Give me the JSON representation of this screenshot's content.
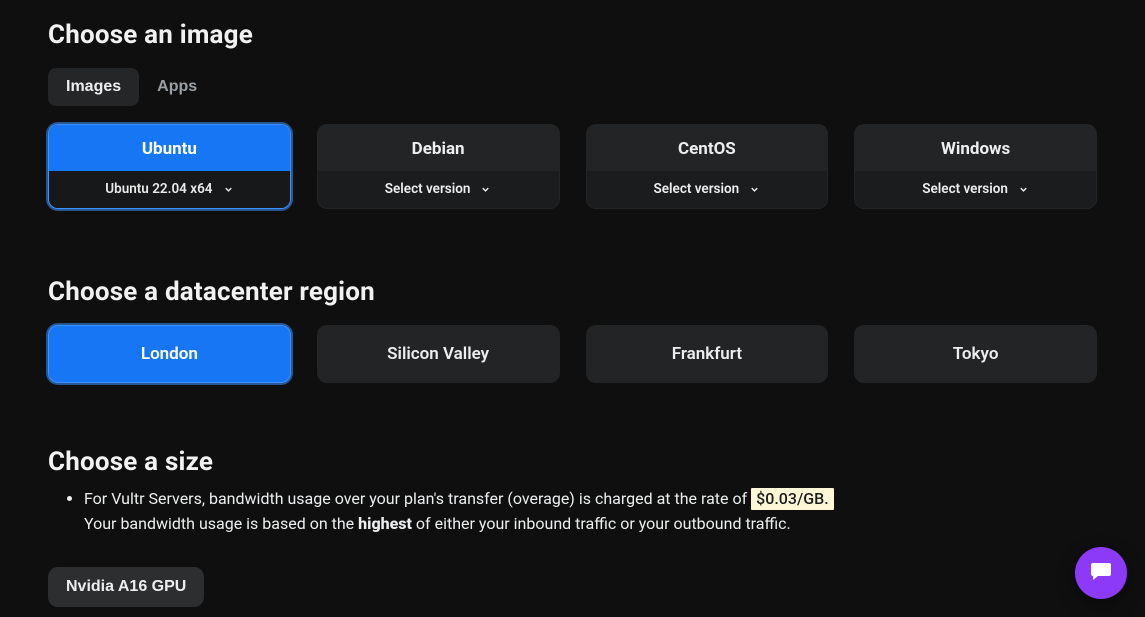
{
  "image": {
    "title": "Choose an image",
    "tabs": [
      {
        "label": "Images",
        "active": true
      },
      {
        "label": "Apps",
        "active": false
      }
    ],
    "os": [
      {
        "name": "Ubuntu",
        "version": "Ubuntu 22.04 x64",
        "selected": true
      },
      {
        "name": "Debian",
        "version": "Select version",
        "selected": false
      },
      {
        "name": "CentOS",
        "version": "Select version",
        "selected": false
      },
      {
        "name": "Windows",
        "version": "Select version",
        "selected": false
      }
    ]
  },
  "region": {
    "title": "Choose a datacenter region",
    "options": [
      {
        "label": "London",
        "selected": true
      },
      {
        "label": "Silicon Valley",
        "selected": false
      },
      {
        "label": "Frankfurt",
        "selected": false
      },
      {
        "label": "Tokyo",
        "selected": false
      }
    ]
  },
  "size": {
    "title": "Choose a size",
    "note": {
      "part1": "For Vultr Servers, bandwidth usage over your plan's transfer (overage) is charged at the rate of ",
      "price": "$0.03/GB.",
      "part2a": "Your bandwidth usage is based on the ",
      "highest": "highest",
      "part2b": " of either your inbound traffic or your outbound traffic."
    },
    "gpu_button": "Nvidia A16 GPU"
  },
  "colors": {
    "accent": "#1676f3"
  }
}
